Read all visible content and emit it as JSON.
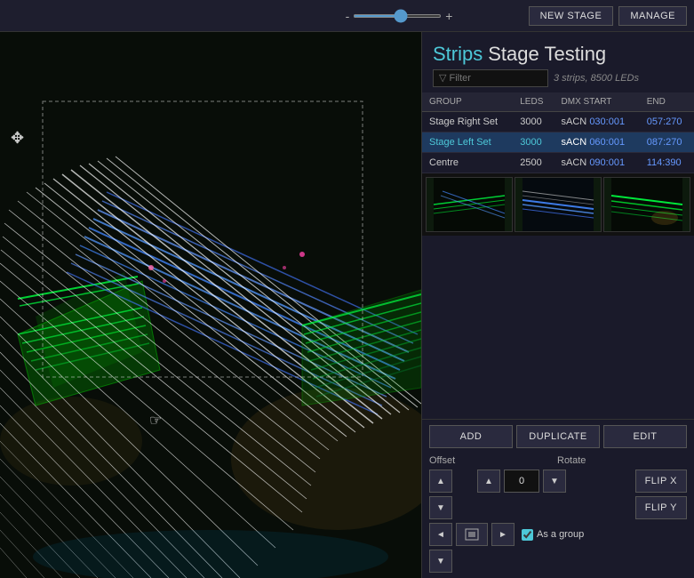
{
  "topbar": {
    "slider_min": "-",
    "slider_max": "+",
    "new_stage_label": "NEW STAGE",
    "manage_label": "MANAGE"
  },
  "panel": {
    "title_colored": "Strips",
    "title_rest": "Stage Testing",
    "subtitle": "3 strips, 8500 LEDs",
    "filter_placeholder": "▽ Filter"
  },
  "table": {
    "headers": [
      "GROUP",
      "LEDS",
      "DMX START",
      "END"
    ],
    "rows": [
      {
        "group": "Stage Right Set",
        "leds": "3000",
        "dmx_start": "sACN 030:001",
        "end": "057:270",
        "selected": false
      },
      {
        "group": "Stage Left Set",
        "leds": "3000",
        "dmx_start": "sACN 060:001",
        "end": "087:270",
        "selected": true
      },
      {
        "group": "Centre",
        "leds": "2500",
        "dmx_start": "sACN 090:001",
        "end": "114:390",
        "selected": false
      }
    ]
  },
  "actions": {
    "add_label": "ADD",
    "duplicate_label": "DUPLICATE",
    "edit_label": "EDIT"
  },
  "offset": {
    "label": "Offset",
    "up_label": "▲",
    "down_label": "▼"
  },
  "rotate": {
    "label": "Rotate",
    "value": "0",
    "up_label": "▲",
    "down_label": "▼",
    "flip_x_label": "FLIP X",
    "flip_y_label": "FLIP Y"
  },
  "move": {
    "left_label": "◄",
    "center_label": "⊞",
    "right_label": "►",
    "down_label": "▼",
    "as_group_label": "As a group"
  }
}
